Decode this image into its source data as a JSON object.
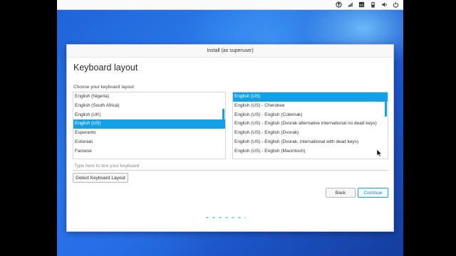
{
  "window": {
    "title": "Install (as superuser)"
  },
  "page": {
    "heading": "Keyboard layout",
    "prompt": "Choose your keyboard layout:"
  },
  "layouts": {
    "items": [
      "English (Nigeria)",
      "English (South Africa)",
      "English (UK)",
      "English (US)",
      "Esperanto",
      "Estonian",
      "Faroese"
    ],
    "selected": "English (US)"
  },
  "variants": {
    "items": [
      "English (US)",
      "English (US) - Cherokee",
      "English (US) - English (Colemak)",
      "English (US) - English (Dvorak alternative international no dead keys)",
      "English (US) - English (Dvorak)",
      "English (US) - English (Dvorak, international with dead keys)",
      "English (US) - English (Macintosh)"
    ],
    "selected": "English (US)"
  },
  "test_field": {
    "placeholder": "Type here to test your keyboard",
    "value": ""
  },
  "buttons": {
    "detect": "Detect Keyboard Layout",
    "back": "Back",
    "continue": "Continue"
  },
  "progress": {
    "total_steps": 7,
    "current_step": 3
  },
  "tray": {
    "icons": [
      "arrow-up-circle-icon",
      "network-icon",
      "keyboard-icon",
      "battery-icon",
      "volume-icon",
      "power-icon"
    ]
  },
  "colors": {
    "accent": "#13a0e6",
    "desktop": "#1f62d8"
  }
}
